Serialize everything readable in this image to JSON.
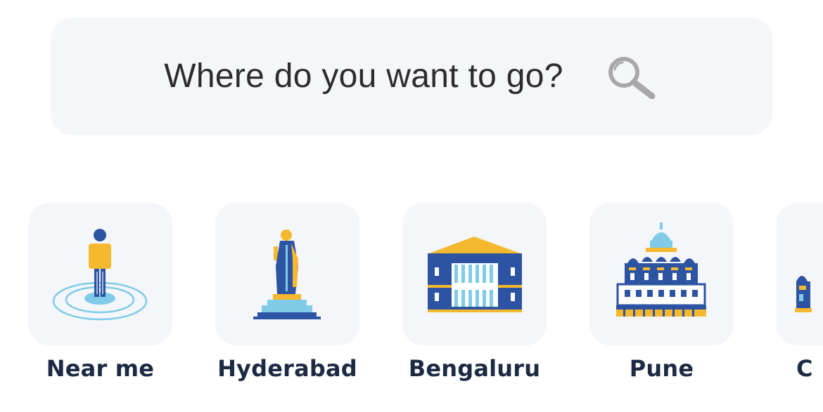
{
  "search": {
    "placeholder": "Where do you want to go?",
    "icon": "search-icon"
  },
  "cities": [
    {
      "label": "Near me",
      "icon": "person-location-icon"
    },
    {
      "label": "Hyderabad",
      "icon": "statue-icon"
    },
    {
      "label": "Bengaluru",
      "icon": "vidhana-soudha-icon"
    },
    {
      "label": "Pune",
      "icon": "palace-icon"
    },
    {
      "label": "C",
      "icon": "monument-icon"
    }
  ],
  "colors": {
    "card_bg": "#f4f6fa",
    "label": "#1d2a44",
    "accent_blue": "#2d54a3",
    "accent_yellow": "#f5b82e",
    "accent_light_blue": "#7fcbe8"
  }
}
